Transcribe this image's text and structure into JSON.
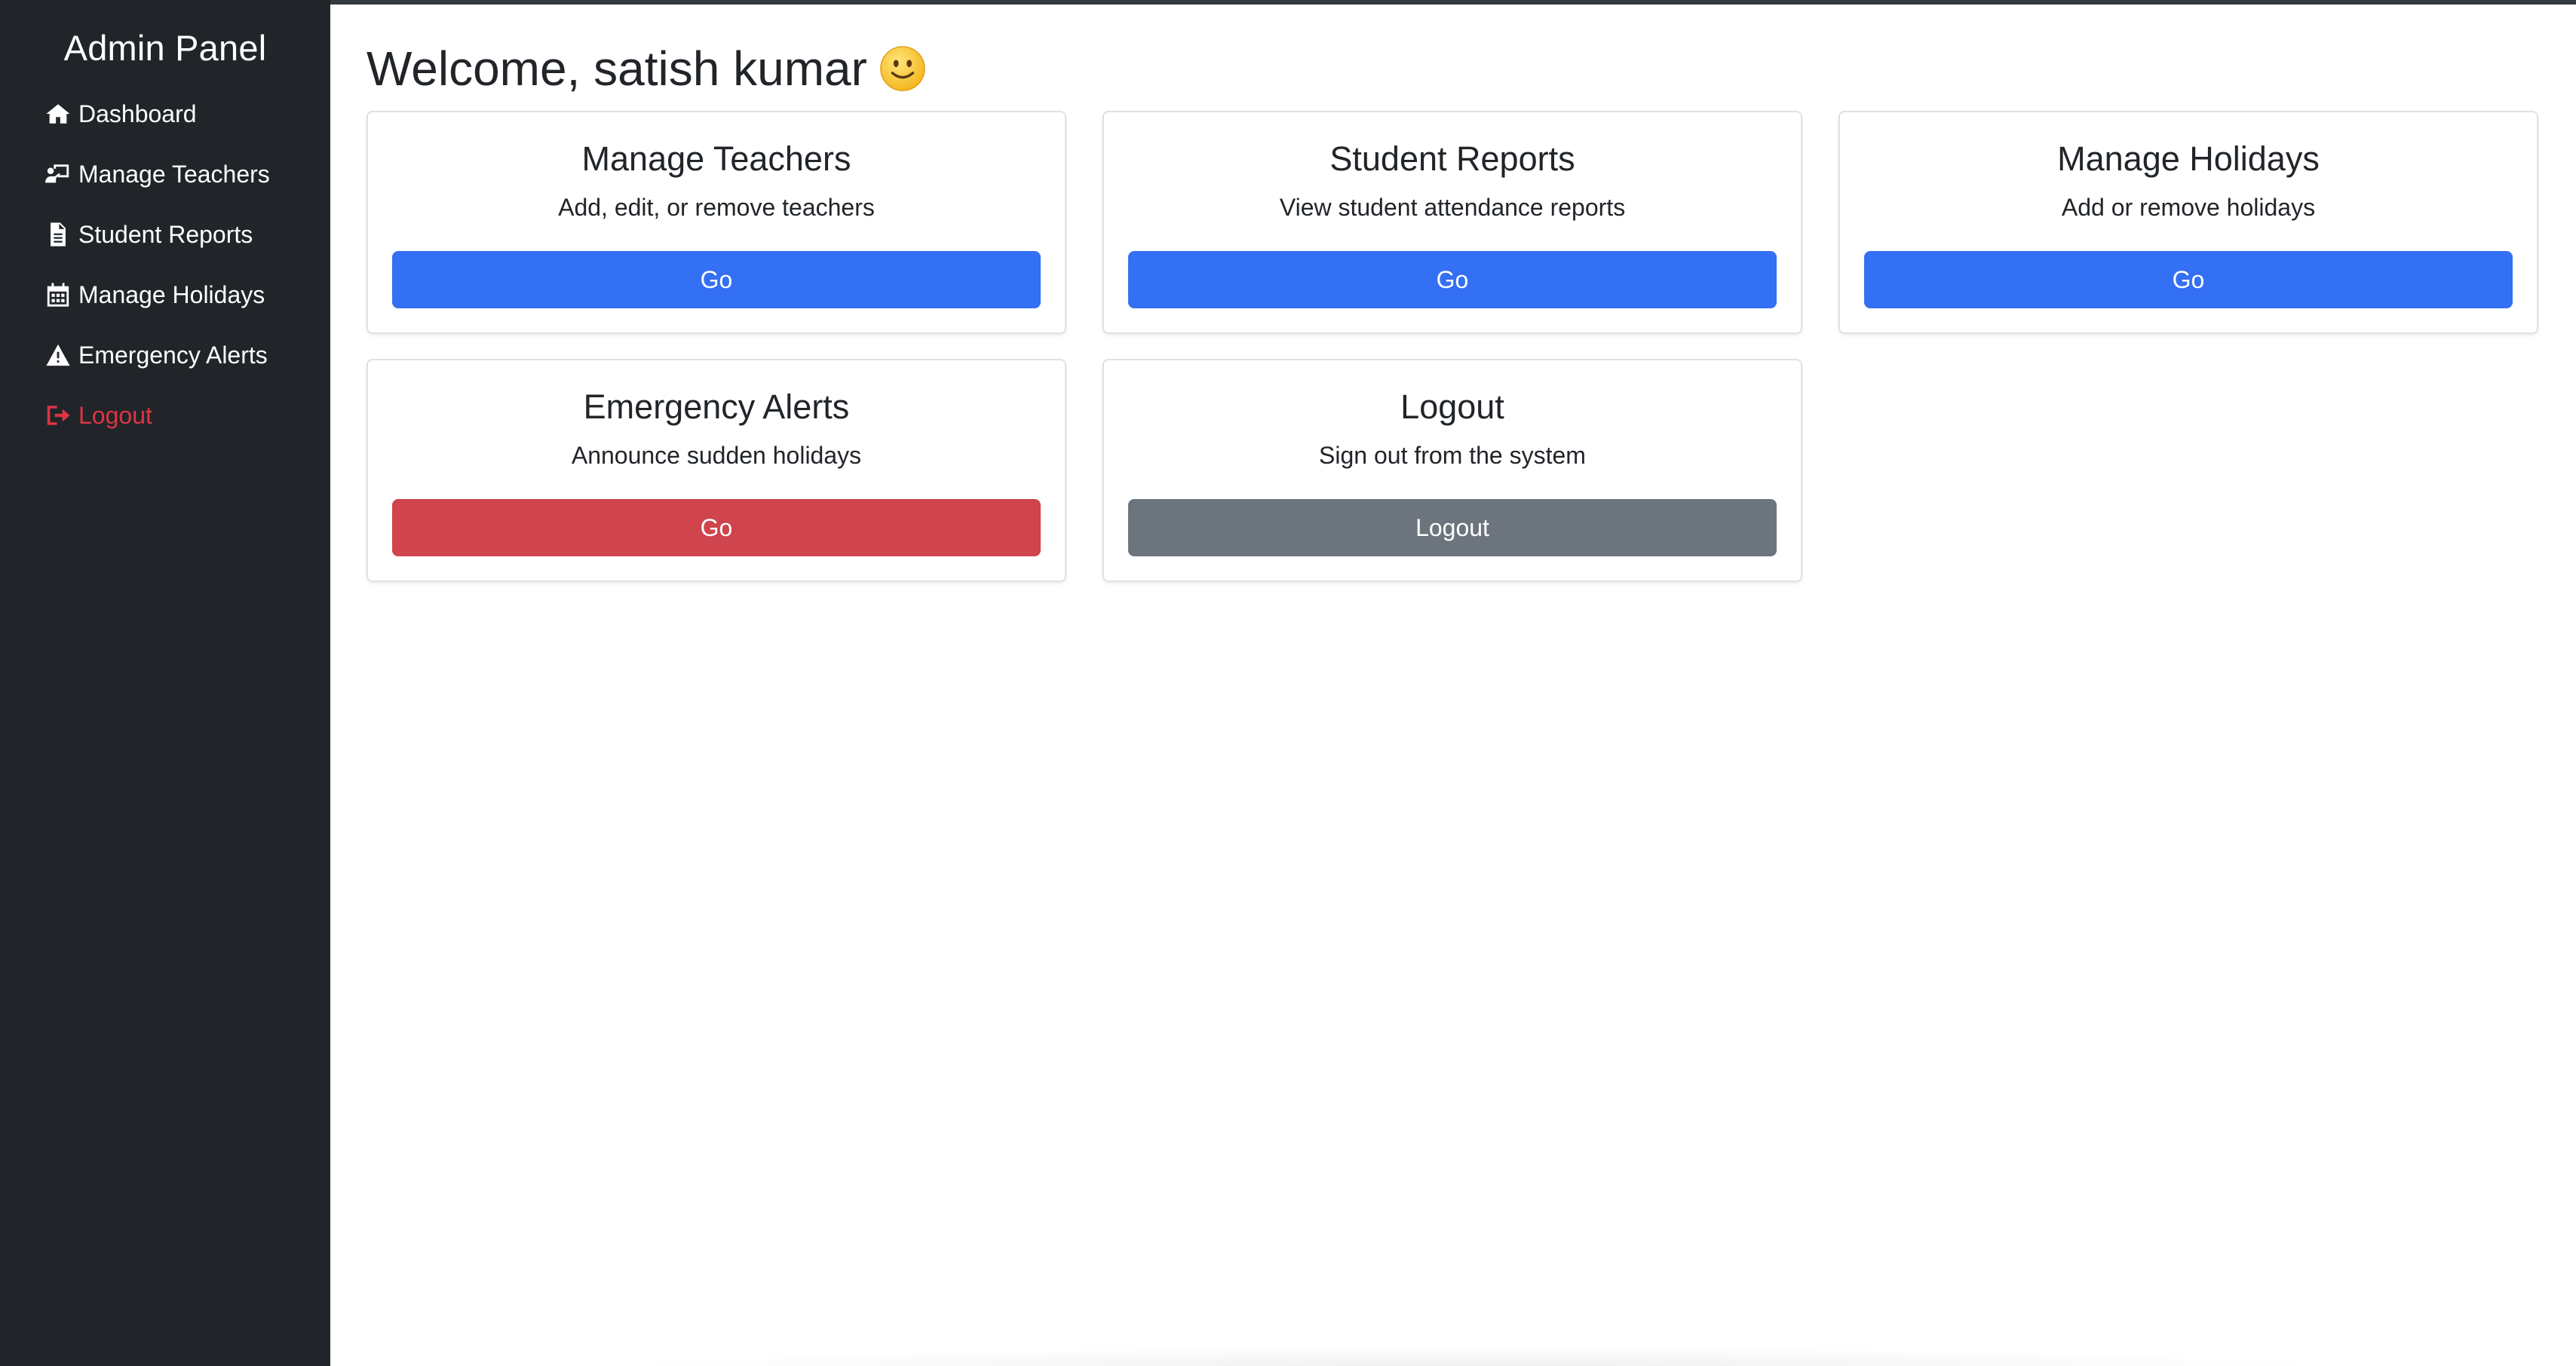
{
  "sidebar": {
    "brand": "Admin Panel",
    "items": [
      {
        "label": "Dashboard",
        "icon": "home-icon"
      },
      {
        "label": "Manage Teachers",
        "icon": "chalkboard-teacher-icon"
      },
      {
        "label": "Student Reports",
        "icon": "file-icon"
      },
      {
        "label": "Manage Holidays",
        "icon": "calendar-icon"
      },
      {
        "label": "Emergency Alerts",
        "icon": "warning-icon"
      },
      {
        "label": "Logout",
        "icon": "sign-out-icon"
      }
    ]
  },
  "main": {
    "welcome": "Welcome, satish kumar",
    "emoji": "smiley-emoji",
    "cards": [
      {
        "title": "Manage Teachers",
        "text": "Add, edit, or remove teachers",
        "button": "Go"
      },
      {
        "title": "Student Reports",
        "text": "View student attendance reports",
        "button": "Go"
      },
      {
        "title": "Manage Holidays",
        "text": "Add or remove holidays",
        "button": "Go"
      },
      {
        "title": "Emergency Alerts",
        "text": "Announce sudden holidays",
        "button": "Go"
      },
      {
        "title": "Logout",
        "text": "Sign out from the system",
        "button": "Logout"
      }
    ]
  },
  "colors": {
    "sidebar_bg": "#212529",
    "primary": "#3370f3",
    "danger": "#cf444d",
    "secondary": "#6c757d",
    "logout_text": "#dc3545"
  }
}
